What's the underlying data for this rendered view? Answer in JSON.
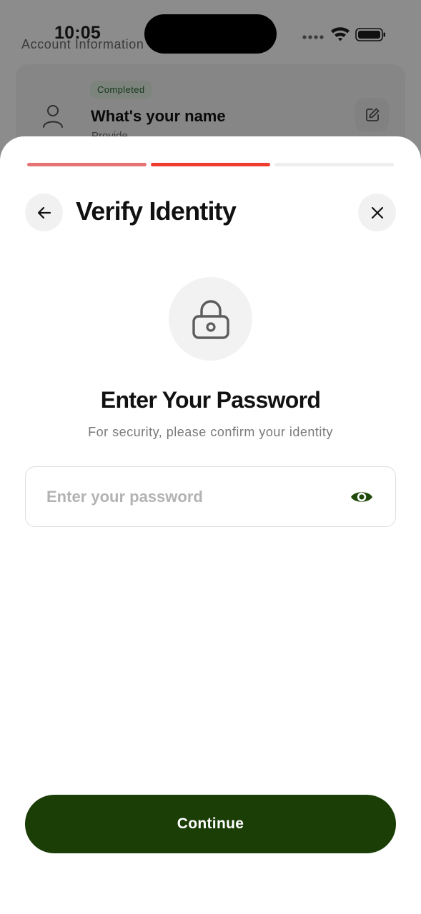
{
  "status_bar": {
    "time": "10:05",
    "icons": [
      "cellular-dots-icon",
      "wifi-icon",
      "battery-icon"
    ]
  },
  "background_page": {
    "section_title": "Account Information",
    "card": {
      "badge": "Completed",
      "title": "What's your name",
      "subtitle": "Provide",
      "icons": [
        "user-icon",
        "edit-icon"
      ]
    }
  },
  "sheet": {
    "progress": {
      "total_steps": 3,
      "current_step": 2,
      "colors": [
        "#e57373",
        "#f03c2e",
        "#eeeeee"
      ]
    },
    "header": {
      "title": "Verify Identity",
      "icons": [
        "back-arrow-icon",
        "close-icon"
      ]
    },
    "lock_icon": "lock-icon",
    "heading": "Enter Your Password",
    "subheading": "For security, please confirm your identity",
    "password_field": {
      "value": "",
      "placeholder": "Enter your password",
      "toggle_icon": "eye-icon"
    },
    "continue_label": "Continue"
  },
  "colors": {
    "brand_dark_green": "#1b3d06",
    "eye_icon_green": "#1f4a0a",
    "progress_done": "#e57373",
    "progress_active": "#f03c2e",
    "progress_inactive": "#eeeeee",
    "badge_bg": "#e3efe4",
    "badge_text": "#2c6b35"
  }
}
